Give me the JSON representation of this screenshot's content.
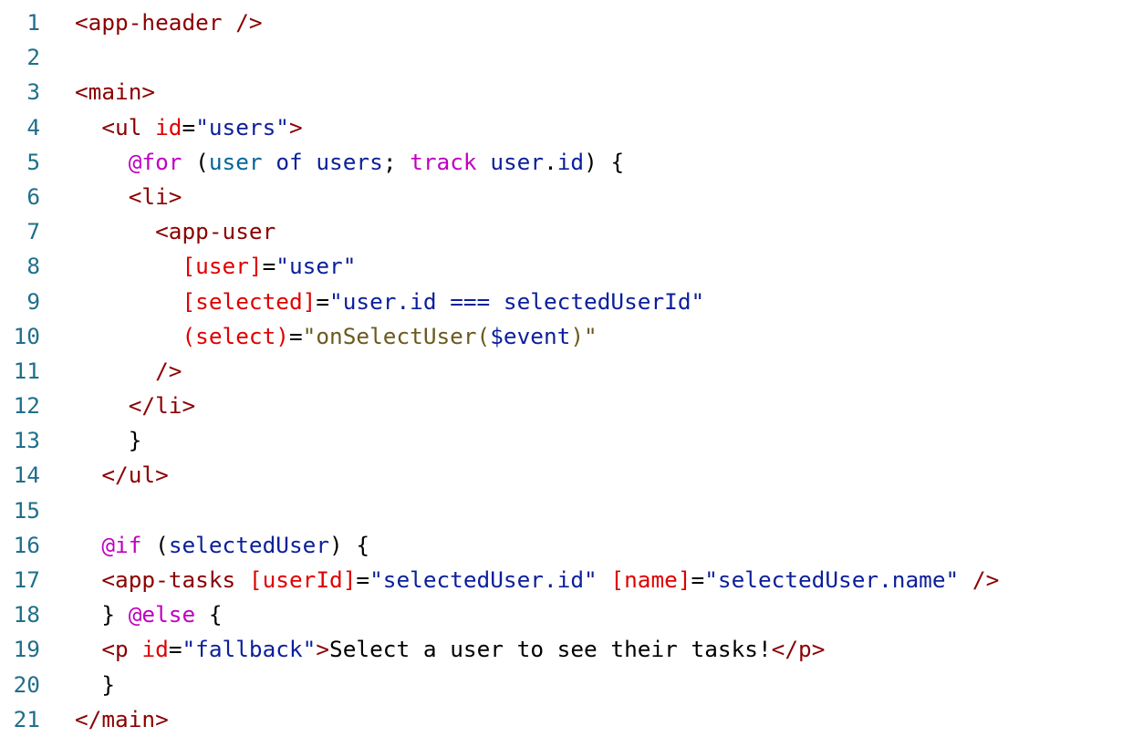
{
  "editor": {
    "colors": {
      "line_number": "#1f6f8b",
      "tag": "#8b0000",
      "attribute": "#e00000",
      "string": "#0b1f9a",
      "keyword": "#c000c0",
      "function": "#6b5a1e"
    },
    "lines": [
      {
        "n": "1",
        "indent": "",
        "tokens": [
          {
            "c": "tag",
            "t": "<app-header />"
          }
        ]
      },
      {
        "n": "2",
        "indent": "",
        "tokens": []
      },
      {
        "n": "3",
        "indent": "",
        "tokens": [
          {
            "c": "tag",
            "t": "<main>"
          }
        ]
      },
      {
        "n": "4",
        "indent": "  ",
        "tokens": [
          {
            "c": "tag",
            "t": "<ul "
          },
          {
            "c": "attr",
            "t": "id"
          },
          {
            "c": "txt",
            "t": "="
          },
          {
            "c": "str",
            "t": "\"users\""
          },
          {
            "c": "tag",
            "t": ">"
          }
        ]
      },
      {
        "n": "5",
        "indent": "    ",
        "tokens": [
          {
            "c": "kw",
            "t": "@for"
          },
          {
            "c": "txt",
            "t": " ("
          },
          {
            "c": "op",
            "t": "user"
          },
          {
            "c": "txt",
            "t": " "
          },
          {
            "c": "var",
            "t": "of"
          },
          {
            "c": "txt",
            "t": " "
          },
          {
            "c": "var",
            "t": "users"
          },
          {
            "c": "txt",
            "t": "; "
          },
          {
            "c": "kw",
            "t": "track"
          },
          {
            "c": "txt",
            "t": " "
          },
          {
            "c": "var",
            "t": "user"
          },
          {
            "c": "txt",
            "t": "."
          },
          {
            "c": "var",
            "t": "id"
          },
          {
            "c": "txt",
            "t": ") {"
          }
        ]
      },
      {
        "n": "6",
        "indent": "    ",
        "tokens": [
          {
            "c": "tag",
            "t": "<li>"
          }
        ]
      },
      {
        "n": "7",
        "indent": "      ",
        "tokens": [
          {
            "c": "tag",
            "t": "<app-user"
          }
        ]
      },
      {
        "n": "8",
        "indent": "        ",
        "tokens": [
          {
            "c": "attr",
            "t": "[user]"
          },
          {
            "c": "txt",
            "t": "="
          },
          {
            "c": "str",
            "t": "\"user\""
          }
        ]
      },
      {
        "n": "9",
        "indent": "        ",
        "tokens": [
          {
            "c": "attr",
            "t": "[selected]"
          },
          {
            "c": "txt",
            "t": "="
          },
          {
            "c": "str",
            "t": "\"user.id === selectedUserId\""
          }
        ]
      },
      {
        "n": "10",
        "indent": "        ",
        "tokens": [
          {
            "c": "attr",
            "t": "(select)"
          },
          {
            "c": "txt",
            "t": "="
          },
          {
            "c": "fn",
            "t": "\"onSelectUser("
          },
          {
            "c": "var",
            "t": "$event"
          },
          {
            "c": "fn",
            "t": ")\""
          }
        ]
      },
      {
        "n": "11",
        "indent": "      ",
        "tokens": [
          {
            "c": "tag",
            "t": "/>"
          }
        ]
      },
      {
        "n": "12",
        "indent": "    ",
        "tokens": [
          {
            "c": "tag",
            "t": "</li>"
          }
        ]
      },
      {
        "n": "13",
        "indent": "    ",
        "tokens": [
          {
            "c": "txt",
            "t": "}"
          }
        ]
      },
      {
        "n": "14",
        "indent": "  ",
        "tokens": [
          {
            "c": "tag",
            "t": "</ul>"
          }
        ]
      },
      {
        "n": "15",
        "indent": "",
        "tokens": []
      },
      {
        "n": "16",
        "indent": "  ",
        "tokens": [
          {
            "c": "kw",
            "t": "@if"
          },
          {
            "c": "txt",
            "t": " ("
          },
          {
            "c": "var",
            "t": "selectedUser"
          },
          {
            "c": "txt",
            "t": ") {"
          }
        ]
      },
      {
        "n": "17",
        "indent": "  ",
        "tokens": [
          {
            "c": "tag",
            "t": "<app-tasks "
          },
          {
            "c": "attr",
            "t": "[userId]"
          },
          {
            "c": "txt",
            "t": "="
          },
          {
            "c": "str",
            "t": "\"selectedUser.id\""
          },
          {
            "c": "txt",
            "t": " "
          },
          {
            "c": "attr",
            "t": "[name]"
          },
          {
            "c": "txt",
            "t": "="
          },
          {
            "c": "str",
            "t": "\"selectedUser.name\""
          },
          {
            "c": "txt",
            "t": " "
          },
          {
            "c": "tag",
            "t": "/>"
          }
        ]
      },
      {
        "n": "18",
        "indent": "  ",
        "tokens": [
          {
            "c": "txt",
            "t": "} "
          },
          {
            "c": "kw",
            "t": "@else"
          },
          {
            "c": "txt",
            "t": " {"
          }
        ]
      },
      {
        "n": "19",
        "indent": "  ",
        "tokens": [
          {
            "c": "tag",
            "t": "<p "
          },
          {
            "c": "attr",
            "t": "id"
          },
          {
            "c": "txt",
            "t": "="
          },
          {
            "c": "str",
            "t": "\"fallback\""
          },
          {
            "c": "tag",
            "t": ">"
          },
          {
            "c": "txt",
            "t": "Select a user to see their tasks!"
          },
          {
            "c": "tag",
            "t": "</p>"
          }
        ]
      },
      {
        "n": "20",
        "indent": "  ",
        "tokens": [
          {
            "c": "txt",
            "t": "}"
          }
        ]
      },
      {
        "n": "21",
        "indent": "",
        "tokens": [
          {
            "c": "tag",
            "t": "</main>"
          }
        ]
      }
    ]
  }
}
